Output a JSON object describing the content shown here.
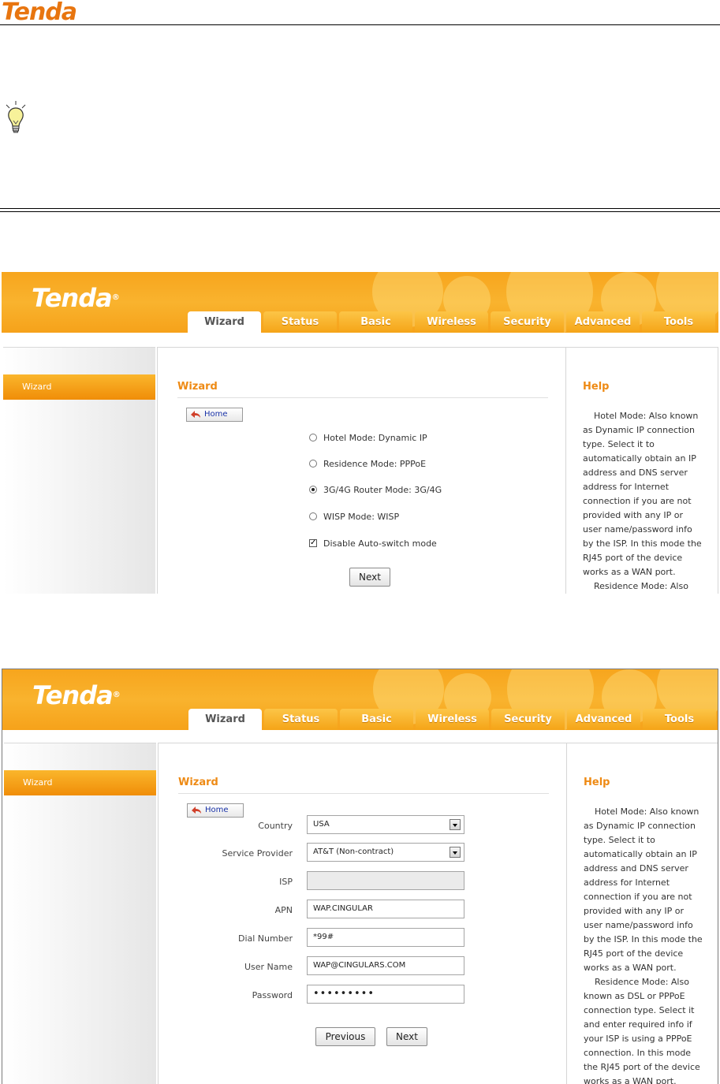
{
  "doc": {
    "logo_text": "Tenda"
  },
  "ui": {
    "logo_text": "Tenda",
    "logo_mark": "®",
    "tabs": [
      "Wizard",
      "Status",
      "Basic",
      "Wireless",
      "Security",
      "Advanced",
      "Tools"
    ],
    "active_tab": "Wizard",
    "sidebar_item": "Wizard",
    "section_title": "Wizard",
    "home_label": "Home",
    "help_title": "Help",
    "colors": {
      "banner": "#f7a51d",
      "accent": "#ee8a14",
      "sidebar_active": "#f5a21a"
    }
  },
  "wizard1": {
    "options": [
      "Hotel Mode: Dynamic IP",
      "Residence Mode: PPPoE",
      "3G/4G Router Mode: 3G/4G",
      "WISP Mode: WISP"
    ],
    "selected_option": "3G/4G Router Mode: 3G/4G",
    "check_mark": "✓",
    "checkbox_label": "Disable Auto-switch mode",
    "next_label": "Next",
    "help_p1": "Hotel Mode: Also known as Dynamic IP connection type. Select it to automatically obtain an IP address and DNS server address for Internet connection if you are not provided with any IP or user name/password info by the ISP. In this mode the RJ45 port of the device works as a WAN port.",
    "help_p2": "Residence Mode: Also"
  },
  "wizard2": {
    "fields": [
      {
        "label": "Country",
        "value": "USA"
      },
      {
        "label": "Service Provider",
        "value": "AT&T (Non-contract)"
      },
      {
        "label": "ISP",
        "value": ""
      },
      {
        "label": "APN",
        "value": "WAP.CINGULAR"
      },
      {
        "label": "Dial Number",
        "value": "*99#"
      },
      {
        "label": "User Name",
        "value": "WAP@CINGULARS.COM"
      },
      {
        "label": "Password",
        "value": "•••••••••"
      }
    ],
    "previous_label": "Previous",
    "next_label": "Next",
    "help_p1": "Hotel Mode: Also known as Dynamic IP connection type. Select it to automatically obtain an IP address and DNS server address for Internet connection if you are not provided with any IP or user name/password info by the ISP. In this mode the RJ45 port of the device works as a WAN port.",
    "help_p2": "Residence Mode: Also known as DSL or PPPoE connection type. Select it and enter required info if your ISP is using a PPPoE connection. In this mode the RJ45 port of the device works as a WAN port."
  }
}
